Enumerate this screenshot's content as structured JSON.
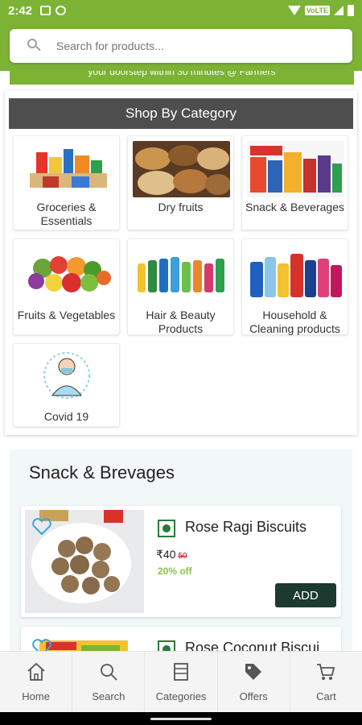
{
  "status_bar": {
    "time": "2:42",
    "network_badge": "VoLTE"
  },
  "search": {
    "placeholder": "Search for products..."
  },
  "banner": {
    "text": "your doorstep within 30 minutes @ Farmers"
  },
  "categories": {
    "heading": "Shop By Category",
    "items": [
      {
        "label": "Groceries & Essentials"
      },
      {
        "label": "Dry fruits"
      },
      {
        "label": "Snack & Beverages"
      },
      {
        "label": "Fruits & Vegetables"
      },
      {
        "label": "Hair & Beauty Products"
      },
      {
        "label": "Household & Cleaning products"
      },
      {
        "label": "Covid 19"
      }
    ]
  },
  "snacks": {
    "heading": "Snack & Brevages",
    "products": [
      {
        "name": "Rose Ragi Biscuits",
        "price": "₹40",
        "mrp": "50",
        "discount": "20% off",
        "add_label": "ADD"
      },
      {
        "name": "Rose Coconut Biscui..."
      }
    ]
  },
  "bottom_nav": [
    {
      "label": "Home",
      "icon": "home-icon"
    },
    {
      "label": "Search",
      "icon": "search-icon"
    },
    {
      "label": "Categories",
      "icon": "categories-icon"
    },
    {
      "label": "Offers",
      "icon": "tag-icon"
    },
    {
      "label": "Cart",
      "icon": "cart-icon"
    }
  ],
  "colors": {
    "brand_green": "#7cb335",
    "header_dark": "#4e4e4e",
    "add_button": "#1c3a2f",
    "discount_green": "#8bc34a",
    "mrp_red": "#d0021b"
  }
}
